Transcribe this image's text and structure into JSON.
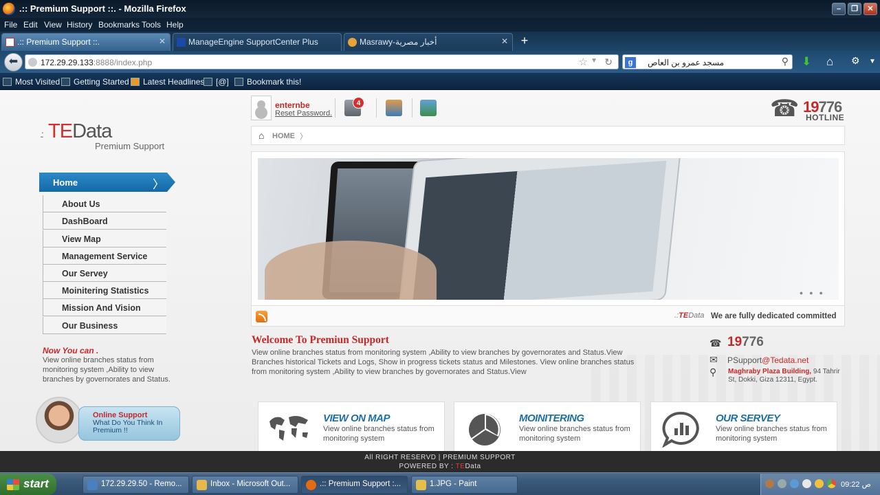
{
  "window": {
    "title": ".:: Premium Support ::. - Mozilla Firefox"
  },
  "menu": [
    "File",
    "Edit",
    "View",
    "History",
    "Bookmarks",
    "Tools",
    "Help"
  ],
  "tabs": [
    {
      "label": ".:: Premium Support ::.",
      "active": true
    },
    {
      "label": "ManageEngine SupportCenter Plus",
      "active": false
    },
    {
      "label": "Masrawy-أخبار مصرية",
      "active": false
    }
  ],
  "nav": {
    "url_host": "172.29.29.133",
    "url_rest": ":8888/index.php",
    "search_value": "مسجد عمرو بن العاص"
  },
  "bookmarks": [
    "Most Visited",
    "Getting Started",
    "Latest Headlines",
    "[@]",
    "Bookmark this!"
  ],
  "site": {
    "logo_te": "TE",
    "logo_data": "Data",
    "logo_sub": "Premium Support",
    "user_name": "enternbe",
    "reset_password": "Reset Password.",
    "notification_count": "4",
    "hotline_prefix": "19",
    "hotline_suffix": "776",
    "hotline_label": "HOTLINE",
    "breadcrumb_home": "HOME",
    "ticker_logo_te": "TE",
    "ticker_logo_data": "Data",
    "ticker_text": "We are fully dedicated committed"
  },
  "sidebar": {
    "home": "Home",
    "items": [
      "About Us",
      "DashBoard",
      "View Map",
      "Management Service",
      "Our Servey",
      "Moinitering Statistics",
      "Mission And Vision",
      "Our Business"
    ],
    "now_title": "Now You can .",
    "now_text": "View online branches status from monitoring system ,Ability to view branches by governorates and Status.",
    "online_title": "Online Support",
    "online_text": "What Do You Think In Premium !!"
  },
  "welcome": {
    "title": "Welcome To Premiun Support",
    "text": "View online branches status from monitoring system ,Ability to view branches by governorates and Status.View Branches historical Tickets and Logs, Show in progress tickets status and Milestones. View online branches status from monitoring system ,Ability to view branches by governorates and Status.View"
  },
  "contact": {
    "phone_prefix": "19",
    "phone_suffix": "776",
    "email_user": "PSupport",
    "email_domain": "@Tedata.net",
    "addr_bold": "Maghraby Plaza Building,",
    "addr_rest": " 94 Tahrir St, Dokki, Giza 12311, Egypt."
  },
  "cards": [
    {
      "title": "VIEW ON MAP",
      "desc": "View online branches status from monitoring system",
      "icon": "world-map-icon"
    },
    {
      "title": "MOINITERING",
      "desc": "View online branches status from monitoring system",
      "icon": "pie-chart-icon"
    },
    {
      "title": "OUR SERVEY",
      "desc": "View online branches status from monitoring system",
      "icon": "survey-chat-icon"
    }
  ],
  "footer": {
    "line1": "All RIGHT RESERVD | PREMIUM SUPPORT",
    "line2_prefix": "POWERED BY : ",
    "line2_te": "TE",
    "line2_data": "Data"
  },
  "taskbar": {
    "start": "start",
    "tasks": [
      "172.29.29.50 - Remo...",
      "Inbox - Microsoft Out...",
      ".:: Premium Support :...",
      "1.JPG - Paint"
    ],
    "clock": "09:22 ص"
  },
  "colors": {
    "brand_red": "#c62828",
    "menu_blue": "#1668a6",
    "card_title_blue": "#1d6fa8"
  }
}
